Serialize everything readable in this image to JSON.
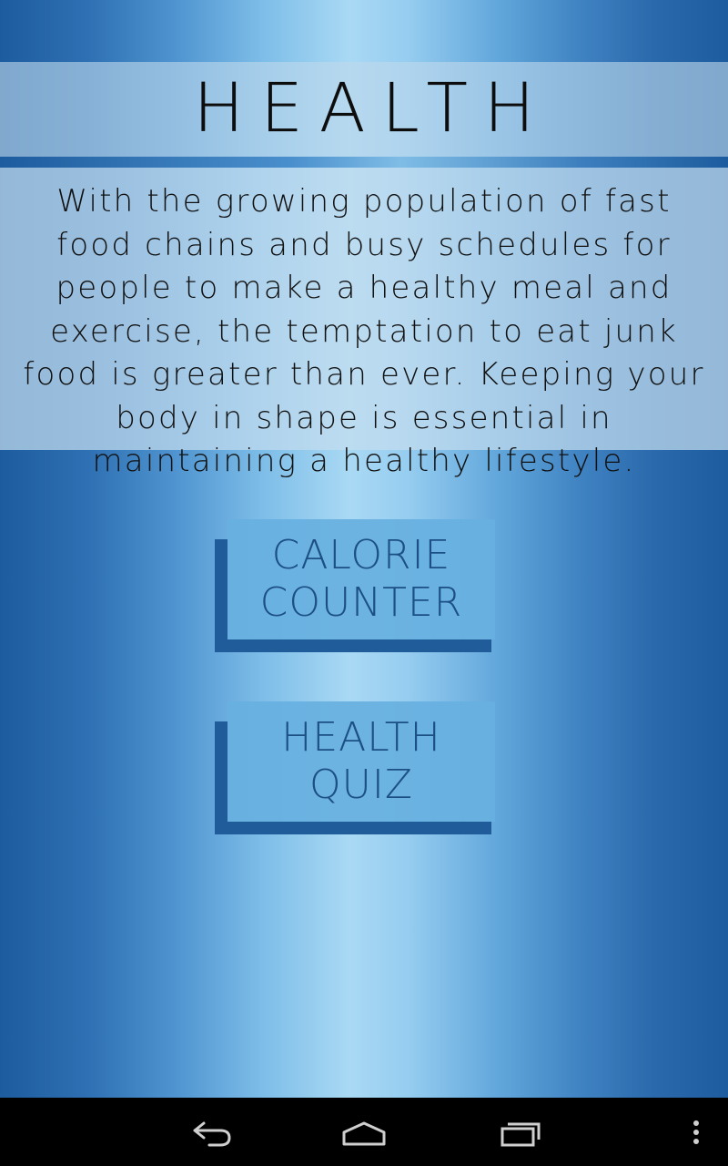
{
  "screen": {
    "title": "HEALTH",
    "description": "With the growing population of fast food chains and busy schedules for people to make a healthy meal and exercise, the temptation to eat junk food is greater than ever. Keeping your body in shape is essential in maintaining a healthy lifestyle."
  },
  "buttons": {
    "calorie_counter": "CALORIE\nCOUNTER",
    "health_quiz": "HEALTH QUIZ"
  },
  "navbar": {
    "back_icon": "back-arrow-icon",
    "home_icon": "home-icon",
    "recents_icon": "recent-apps-icon",
    "menu_icon": "overflow-menu-icon"
  },
  "colors": {
    "button_face": "#67b0df",
    "button_shadow": "#1f5c99",
    "button_text": "#1c4f84",
    "title_text": "#0d0d0d",
    "navbar": "#000000"
  }
}
